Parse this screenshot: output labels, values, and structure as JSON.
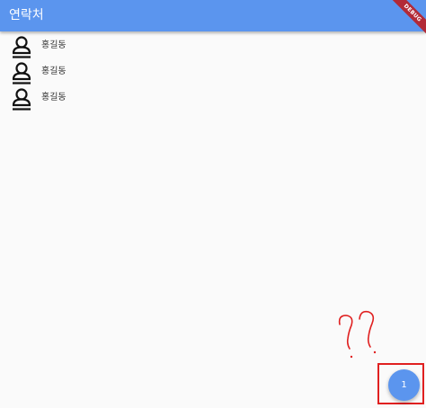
{
  "appbar": {
    "title": "연락처",
    "color": "#5b95ee"
  },
  "debug_banner": {
    "label": "DEBUG",
    "color": "#b22a37"
  },
  "contacts": [
    {
      "name": "홍길동",
      "icon": "person-icon"
    },
    {
      "name": "홍길동",
      "icon": "person-icon"
    },
    {
      "name": "홍길동",
      "icon": "person-icon"
    }
  ],
  "fab": {
    "label": "1",
    "color": "#5b95ee"
  },
  "annotation": {
    "color": "#e02020"
  }
}
